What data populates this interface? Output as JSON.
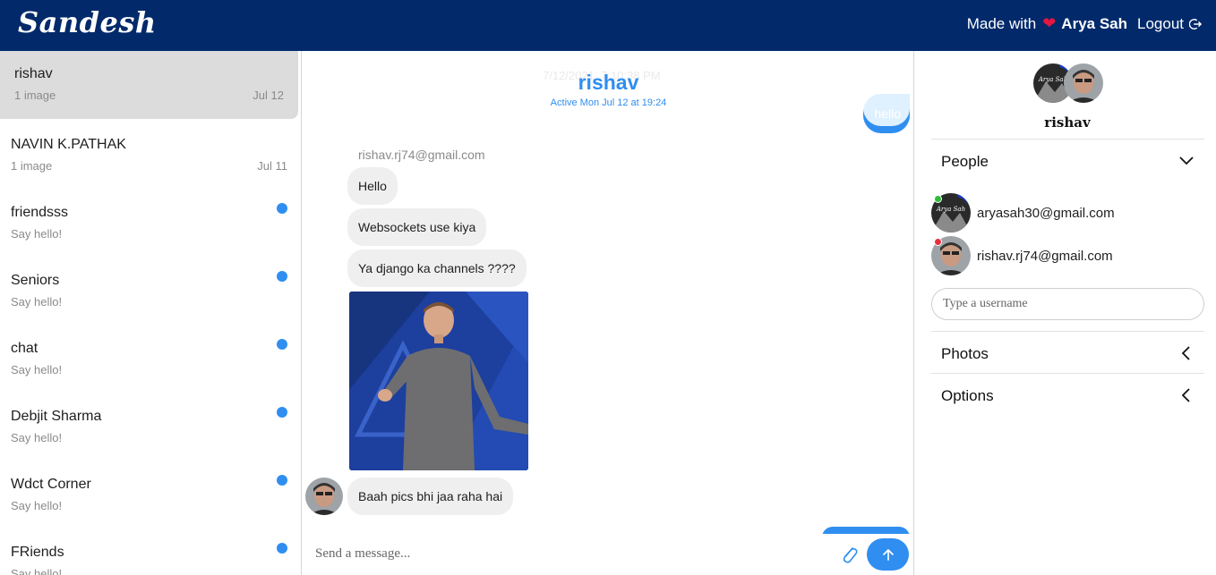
{
  "header": {
    "brand": "Sandesh",
    "made_with": "Made with",
    "heart_icon": "heart-icon",
    "author": "Arya Sah",
    "logout": "Logout",
    "colors": {
      "bar": "#022a6b",
      "heart": "#e3173f"
    }
  },
  "sidebar": {
    "conversations": [
      {
        "name": "rishav",
        "subtitle": "1 image",
        "date": "Jul 12",
        "active": true
      },
      {
        "name": "NAVIN K.PATHAK",
        "subtitle": "1 image",
        "date": "Jul 11"
      },
      {
        "name": "friendsss",
        "subtitle": "Say hello!",
        "unread": true
      },
      {
        "name": "Seniors",
        "subtitle": "Say hello!",
        "unread": true
      },
      {
        "name": "chat",
        "subtitle": "Say hello!",
        "unread": true
      },
      {
        "name": "Debjit Sharma",
        "subtitle": "Say hello!",
        "unread": true
      },
      {
        "name": "Wdct Corner",
        "subtitle": "Say hello!",
        "unread": true
      },
      {
        "name": "FRiends",
        "subtitle": "Say hello!",
        "unread": true
      }
    ]
  },
  "chat": {
    "title": "rishav",
    "status": "Active Mon Jul 12 at 19:24",
    "faded_date": "7/12/2021, 7:10:38 PM",
    "outgoing_message": "hello",
    "sender_email": "rishav.rj74@gmail.com",
    "incoming_messages": [
      "Hello",
      "Websockets use kiya",
      "Ya django ka channels ????"
    ],
    "last_message": "Baah pics bhi jaa raha hai",
    "composer_placeholder": "Send a message...",
    "accent": "#2f8ef0"
  },
  "panel": {
    "name": "rishav",
    "people_title": "People",
    "people": [
      {
        "email": "aryasah30@gmail.com",
        "status_color": "#2ebd3a"
      },
      {
        "email": "rishav.rj74@gmail.com",
        "status_color": "#e5303c"
      }
    ],
    "search_placeholder": "Type a username",
    "photos_title": "Photos",
    "options_title": "Options"
  }
}
